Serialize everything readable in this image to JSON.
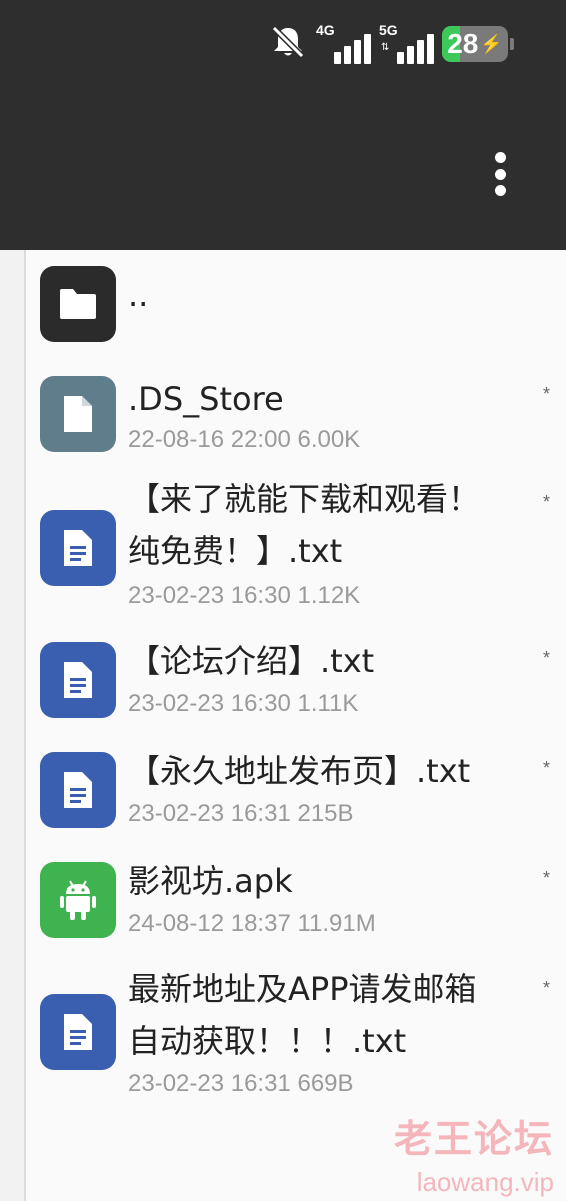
{
  "status_bar": {
    "mute_icon": "bell-slash-icon",
    "net1": {
      "label": "4G",
      "bars": 4
    },
    "net2": {
      "label": "5G",
      "arrows": "⇅",
      "bars": 4
    },
    "battery": {
      "level": 28,
      "text": "28",
      "charging": true,
      "fill_color": "#3cc95a"
    }
  },
  "toolbar": {
    "menu_icon": "more-vert-icon"
  },
  "files": [
    {
      "name": "..",
      "meta": "",
      "icon": "folder-icon",
      "color": "#2b2b2b",
      "marker": ""
    },
    {
      "name": ".DS_Store",
      "meta": "22-08-16 22:00  6.00K",
      "icon": "file-icon",
      "color": "#607d8b",
      "marker": "*"
    },
    {
      "name_lines": [
        "【来了就能下载和观看！",
        "纯免费！】.txt"
      ],
      "meta": "23-02-23 16:30  1.12K",
      "icon": "text-file-icon",
      "color": "#3b5fb0",
      "marker": "*"
    },
    {
      "name": "【论坛介绍】.txt",
      "meta": "23-02-23 16:30  1.11K",
      "icon": "text-file-icon",
      "color": "#3b5fb0",
      "marker": "*"
    },
    {
      "name": "【永久地址发布页】.txt",
      "meta": "23-02-23 16:31  215B",
      "icon": "text-file-icon",
      "color": "#3b5fb0",
      "marker": "*"
    },
    {
      "name": "影视坊.apk",
      "meta": "24-08-12 18:37  11.91M",
      "icon": "android-icon",
      "color": "#3fb34f",
      "marker": "*"
    },
    {
      "name_lines": [
        "最新地址及APP请发邮箱",
        "自动获取！！！.txt"
      ],
      "meta": "23-02-23 16:31  669B",
      "icon": "text-file-icon",
      "color": "#3b5fb0",
      "marker": "*"
    }
  ],
  "watermark": {
    "title": "老王论坛",
    "url": "laowang.vip"
  }
}
